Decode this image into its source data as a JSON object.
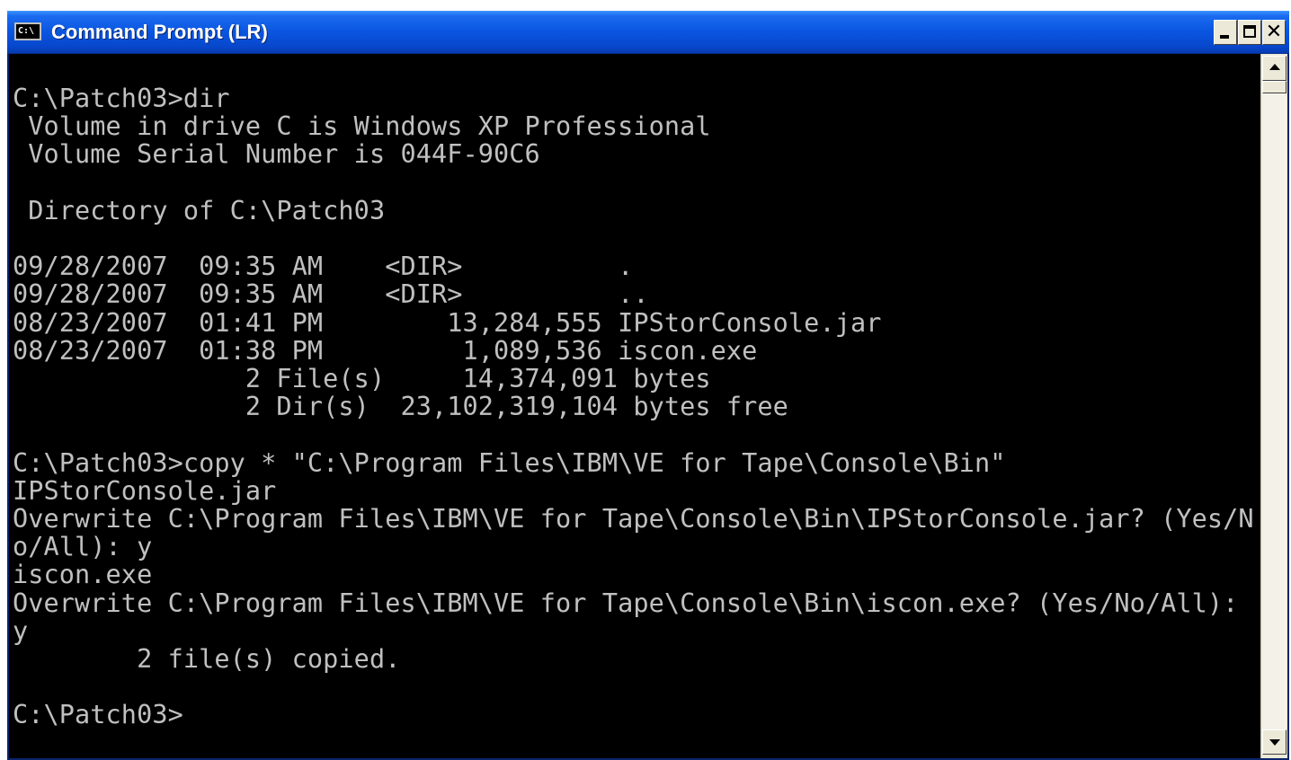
{
  "window": {
    "title": "Command Prompt (LR)",
    "icon": "cmd-icon",
    "icon_text": "C:\\"
  },
  "controls": {
    "minimize": "minimize-icon",
    "maximize": "maximize-icon",
    "close_glyph": "✕"
  },
  "console": {
    "lines": [
      "C:\\Patch03>dir",
      " Volume in drive C is Windows XP Professional",
      " Volume Serial Number is 044F-90C6",
      "",
      " Directory of C:\\Patch03",
      "",
      "09/28/2007  09:35 AM    <DIR>          .",
      "09/28/2007  09:35 AM    <DIR>          ..",
      "08/23/2007  01:41 PM        13,284,555 IPStorConsole.jar",
      "08/23/2007  01:38 PM         1,089,536 iscon.exe",
      "               2 File(s)     14,374,091 bytes",
      "               2 Dir(s)  23,102,319,104 bytes free",
      "",
      "C:\\Patch03>copy * \"C:\\Program Files\\IBM\\VE for Tape\\Console\\Bin\"",
      "IPStorConsole.jar",
      "Overwrite C:\\Program Files\\IBM\\VE for Tape\\Console\\Bin\\IPStorConsole.jar? (Yes/N",
      "o/All): y",
      "iscon.exe",
      "Overwrite C:\\Program Files\\IBM\\VE for Tape\\Console\\Bin\\iscon.exe? (Yes/No/All):",
      "y",
      "        2 file(s) copied.",
      "",
      "C:\\Patch03>"
    ]
  },
  "colors": {
    "console_bg": "#000000",
    "console_fg": "#c0c0c0",
    "titlebar": "#0a55e0"
  }
}
